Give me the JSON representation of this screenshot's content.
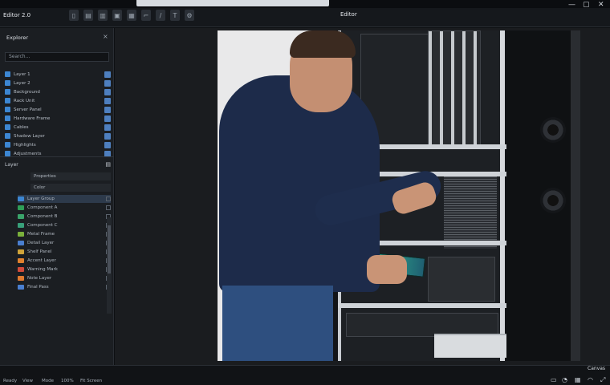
{
  "app": {
    "title": "Editor 2.0"
  },
  "document": {
    "title": "Editor"
  },
  "toolbar": {
    "tools": [
      {
        "icon": "new-file-icon",
        "glyph": "▯"
      },
      {
        "icon": "open-folder-icon",
        "glyph": "▤"
      },
      {
        "icon": "save-icon",
        "glyph": "▥"
      },
      {
        "icon": "image-icon",
        "glyph": "▣"
      },
      {
        "icon": "layers-icon",
        "glyph": "▦"
      },
      {
        "icon": "crop-icon",
        "glyph": "⌐"
      },
      {
        "icon": "brush-icon",
        "glyph": "/"
      },
      {
        "icon": "text-icon",
        "glyph": "T"
      },
      {
        "icon": "settings-icon",
        "glyph": "⚙"
      }
    ]
  },
  "window_controls": {
    "minimize": "—",
    "maximize": "▢",
    "close": "✕"
  },
  "panel": {
    "header": "Explorer",
    "search_placeholder": "Search...",
    "layers": [
      {
        "label": "Layer 1"
      },
      {
        "label": "Layer 2"
      },
      {
        "label": "Background"
      },
      {
        "label": "Rack Unit"
      },
      {
        "label": "Server Panel"
      },
      {
        "label": "Hardware Frame"
      },
      {
        "label": "Cables"
      },
      {
        "label": "Shadow Layer"
      },
      {
        "label": "Highlights"
      },
      {
        "label": "Adjustments"
      }
    ]
  },
  "properties": {
    "header": "Layer",
    "field_1": "Properties",
    "field_2": "Color",
    "items": [
      {
        "label": "Layer Group",
        "color": "#3c86d2",
        "selected": true
      },
      {
        "label": "Component A",
        "color": "#2f9e57"
      },
      {
        "label": "Component B",
        "color": "#3aa36a"
      },
      {
        "label": "Component C",
        "color": "#38a07a"
      },
      {
        "label": "Metal Frame",
        "color": "#7ab03b"
      },
      {
        "label": "Detail Layer",
        "color": "#4a7fd0"
      },
      {
        "label": "Shelf Panel",
        "color": "#d0a43a"
      },
      {
        "label": "Accent Layer",
        "color": "#e0822f"
      },
      {
        "label": "Warning Mark",
        "color": "#d24b3a"
      },
      {
        "label": "Note Layer",
        "color": "#e07a2f"
      },
      {
        "label": "Final Pass",
        "color": "#4a7fd0"
      }
    ]
  },
  "status": {
    "items": [
      "Ready",
      "View",
      "Mode",
      "100%",
      "Fit Screen"
    ],
    "right_icons": [
      "monitor-icon",
      "bell-icon",
      "grid-icon",
      "wifi-icon"
    ],
    "brand": "Canvas"
  }
}
